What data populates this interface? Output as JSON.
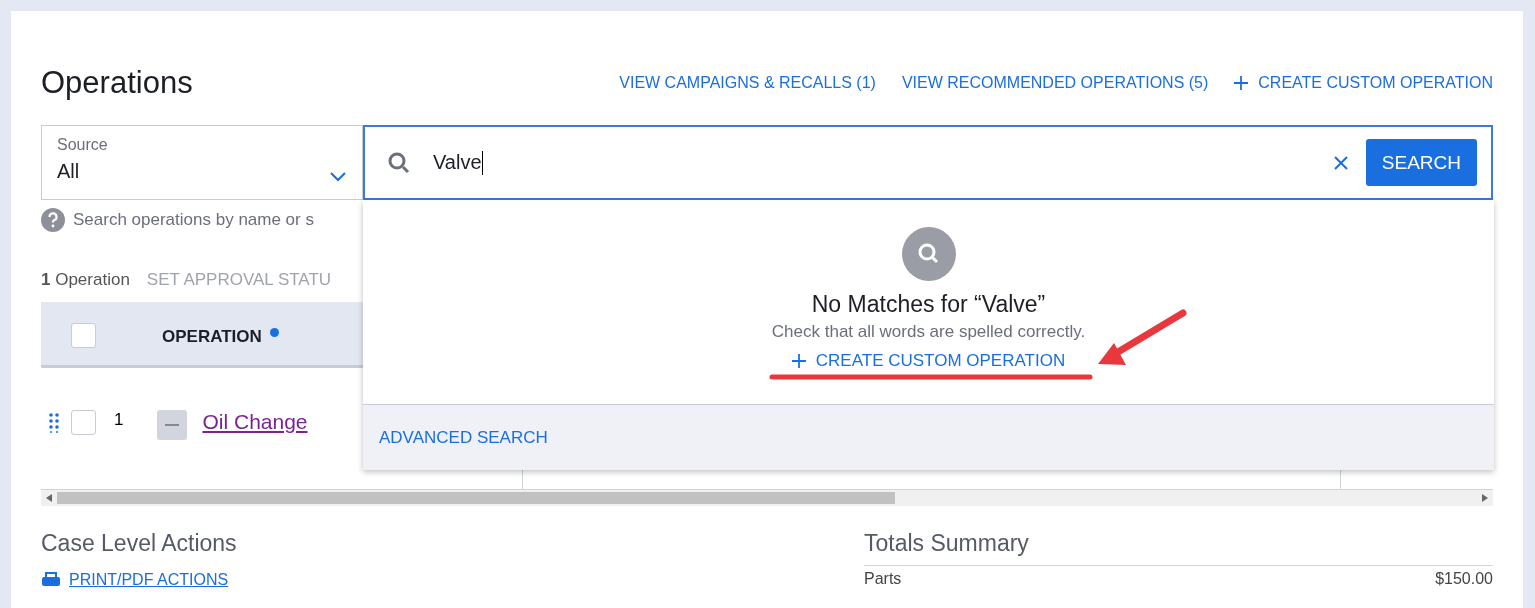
{
  "page": {
    "title": "Operations",
    "header_links": [
      {
        "kind": "link",
        "label": "VIEW CAMPAIGNS & RECALLS (1)"
      },
      {
        "kind": "link",
        "label": "VIEW RECOMMENDED OPERATIONS (5)"
      },
      {
        "kind": "create",
        "label": "CREATE CUSTOM OPERATION"
      }
    ]
  },
  "source": {
    "label": "Source",
    "value": "All"
  },
  "search": {
    "value": "Valve",
    "button": "SEARCH"
  },
  "hint": "Search operations by name or s",
  "table": {
    "count": "1",
    "count_label": "Operation",
    "bulk_action": "SET APPROVAL STATU",
    "header_checked": false,
    "columns": [
      {
        "label": "OPERATION"
      }
    ],
    "rows": [
      {
        "number": "1",
        "name": "Oil Change",
        "checked": false
      }
    ]
  },
  "dropdown": {
    "title": "No Matches for “Valve”",
    "subtitle": "Check that all words are spelled correctly.",
    "create": "CREATE CUSTOM OPERATION",
    "footer": "ADVANCED SEARCH"
  },
  "case_actions": {
    "title": "Case Level Actions",
    "links": [
      "PRINT/PDF ACTIONS"
    ]
  },
  "totals": {
    "title": "Totals Summary",
    "rows": [
      {
        "label": "Parts",
        "value": "$150.00"
      }
    ]
  }
}
